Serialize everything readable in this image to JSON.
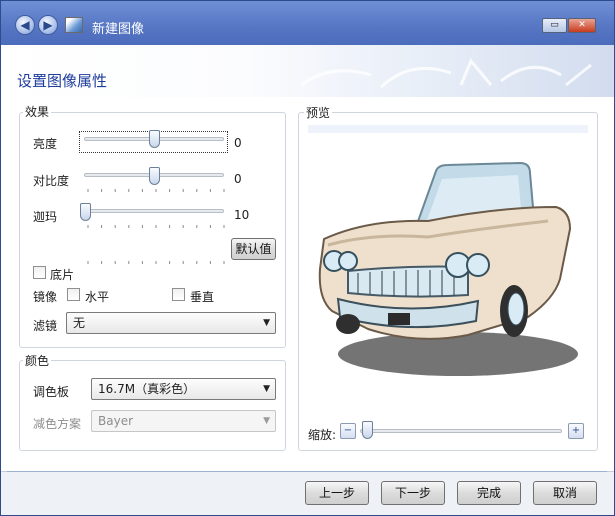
{
  "window": {
    "title": "新建图像",
    "restore_symbol": "▭",
    "close_symbol": "✕",
    "back_symbol": "◀",
    "forward_symbol": "▶"
  },
  "page": {
    "title": "设置图像属性"
  },
  "effects": {
    "legend": "效果",
    "brightness": {
      "label": "亮度",
      "value": "0",
      "level": 0.5
    },
    "contrast": {
      "label": "对比度",
      "value": "0",
      "level": 0.5
    },
    "gamma": {
      "label": "迦玛",
      "value": "10",
      "level": 0.0
    },
    "default_button": "默认值",
    "negative_label": "底片",
    "mirror_label": "镜像",
    "horizontal_label": "水平",
    "vertical_label": "垂直",
    "filter_label": "滤镜",
    "filter_value": "无"
  },
  "color": {
    "legend": "颜色",
    "palette_label": "调色板",
    "palette_value": "16.7M（真彩色）",
    "dither_label": "减色方案",
    "dither_value": "Bayer"
  },
  "preview": {
    "legend": "预览",
    "zoom_label": "缩放:",
    "zoom_out_symbol": "−",
    "zoom_in_symbol": "+",
    "zoom_level": 0.0
  },
  "footer": {
    "back": "上一步",
    "next": "下一步",
    "finish": "完成",
    "cancel": "取消"
  },
  "colors": {
    "title_bar": "#5676c4",
    "page_title": "#1e3c9c",
    "car_body": "#eee0cc",
    "chrome": "#c3dbe8"
  }
}
